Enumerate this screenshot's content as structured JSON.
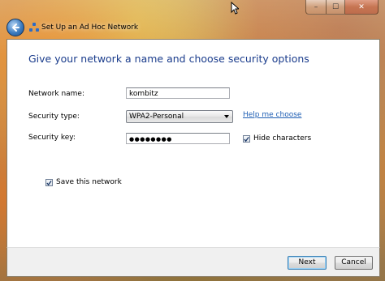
{
  "window": {
    "title": "Set Up an Ad Hoc Network",
    "caption": {
      "minimize": "–",
      "maximize": "☐",
      "close": "✕"
    }
  },
  "icons": {
    "back": "back-arrow-icon",
    "network": "network-icon"
  },
  "page": {
    "heading": "Give your network a name and choose security options",
    "network_name": {
      "label": "Network name:",
      "value": "kombitz"
    },
    "security_type": {
      "label": "Security type:",
      "value": "WPA2-Personal"
    },
    "help_link": "Help me choose",
    "security_key": {
      "label": "Security key:",
      "value": "●●●●●●●●"
    },
    "hide_characters": {
      "label": "Hide characters",
      "checked": true
    },
    "save_network": {
      "label": "Save this network",
      "checked": true
    }
  },
  "footer": {
    "next": "Next",
    "cancel": "Cancel"
  },
  "colors": {
    "heading": "#1a3c8c",
    "link": "#1f5fb4"
  }
}
